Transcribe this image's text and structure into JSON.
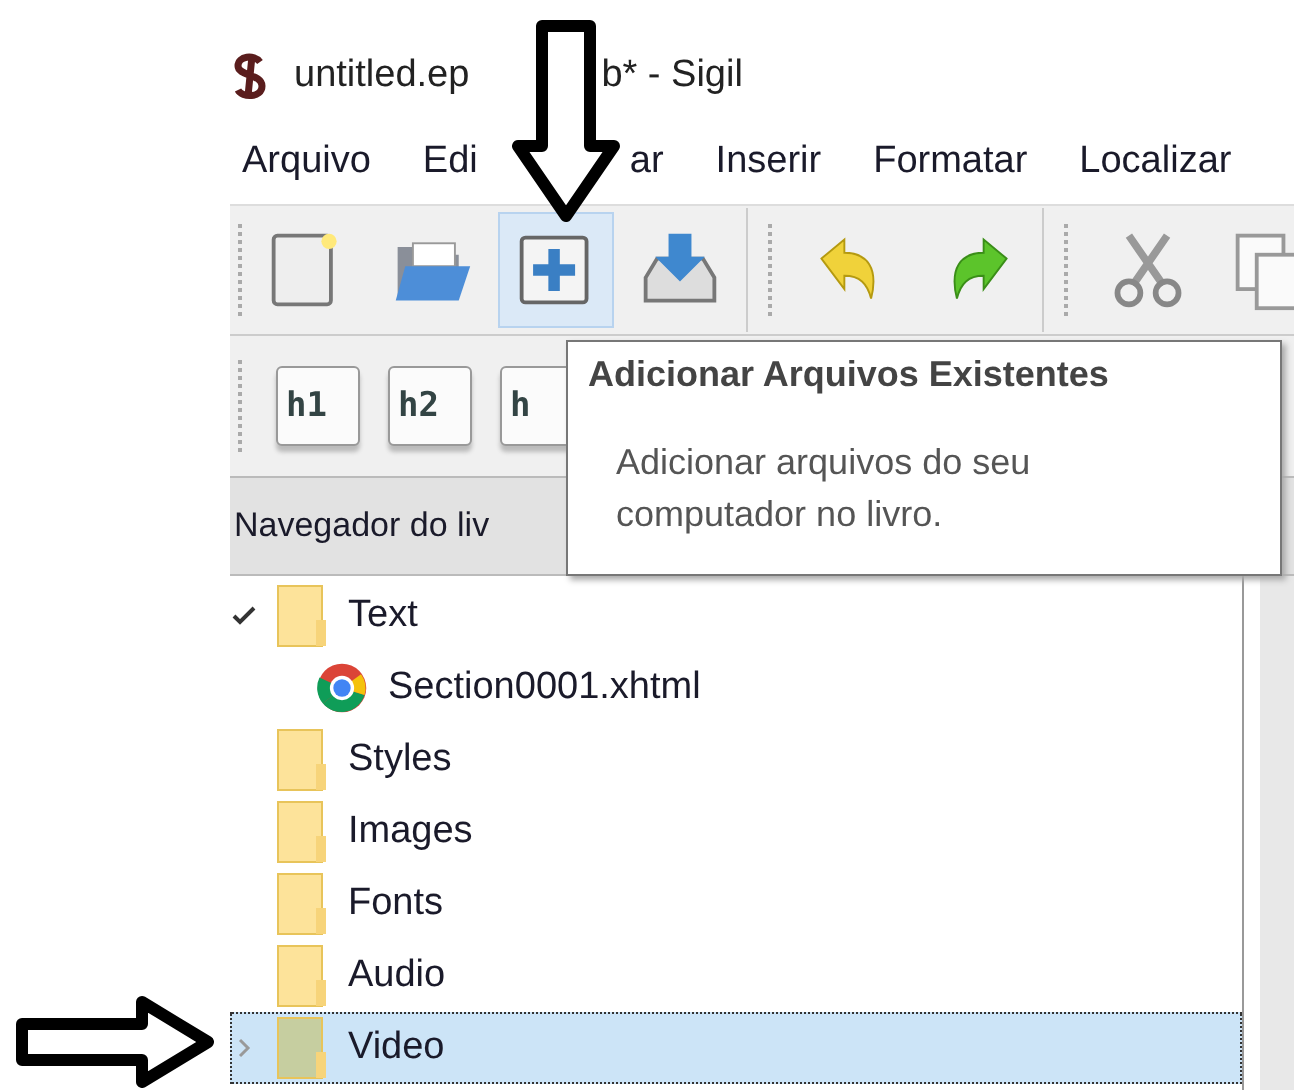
{
  "window": {
    "title_parts": [
      "untitled.ep",
      "b* - Sigil"
    ]
  },
  "menu": [
    {
      "parts": [
        "Arquivo"
      ]
    },
    {
      "parts": [
        "Edi",
        "ar"
      ]
    },
    {
      "parts": [
        "Inserir"
      ]
    },
    {
      "parts": [
        "Formatar"
      ]
    },
    {
      "parts": [
        "Localizar"
      ]
    }
  ],
  "toolbar": [
    {
      "kind": "new",
      "highlighted": false
    },
    {
      "kind": "open",
      "highlighted": false
    },
    {
      "kind": "add",
      "highlighted": true
    },
    {
      "kind": "save",
      "highlighted": false
    },
    {
      "kind": "separator"
    },
    {
      "kind": "undo",
      "highlighted": false
    },
    {
      "kind": "redo",
      "highlighted": false
    },
    {
      "kind": "separator"
    },
    {
      "kind": "cut",
      "highlighted": false
    },
    {
      "kind": "copy",
      "highlighted": false
    }
  ],
  "heading_buttons": [
    "h1",
    "h2",
    "h"
  ],
  "panel": {
    "title": "Navegador do liv"
  },
  "tree": [
    {
      "name": "Text",
      "kind": "folder",
      "expanded": true,
      "selected": false,
      "children": [
        {
          "name": "Section0001.xhtml",
          "kind": "file",
          "selected": false
        }
      ]
    },
    {
      "name": "Styles",
      "kind": "folder",
      "selected": false
    },
    {
      "name": "Images",
      "kind": "folder",
      "selected": false
    },
    {
      "name": "Fonts",
      "kind": "folder",
      "selected": false
    },
    {
      "name": "Audio",
      "kind": "folder",
      "selected": false
    },
    {
      "name": "Video",
      "kind": "folder",
      "expanded": false,
      "selected": true
    }
  ],
  "tooltip": {
    "title": "Adicionar Arquivos Existentes",
    "text": "Adicionar arquivos do seu computador no livro."
  }
}
